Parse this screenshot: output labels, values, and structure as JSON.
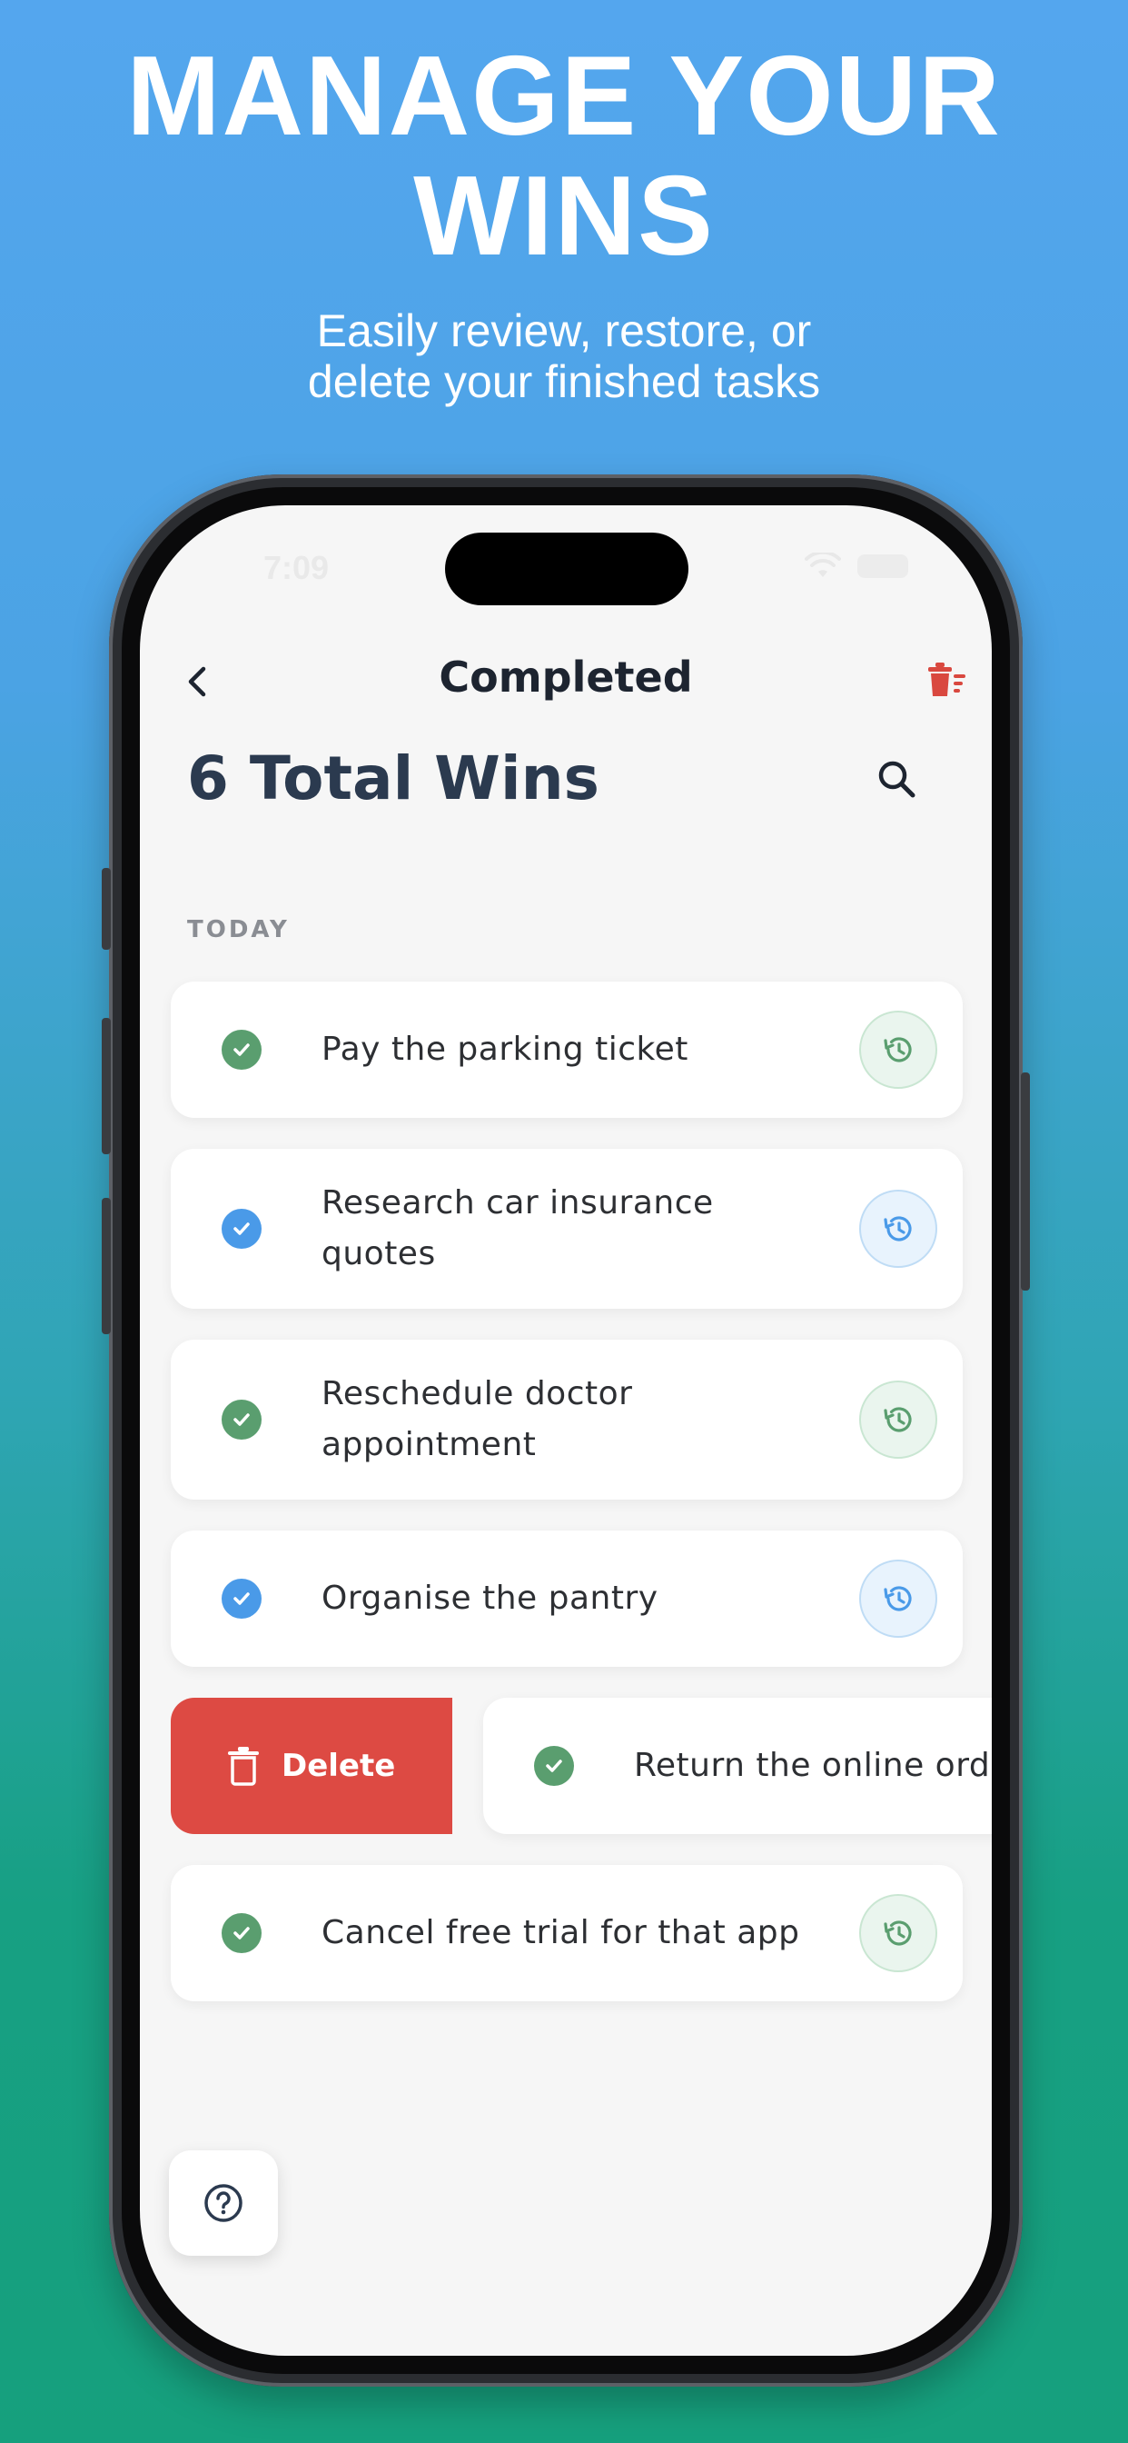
{
  "promo": {
    "headline_line1": "MANAGE YOUR",
    "headline_line2": "WINS",
    "subhead_line1": "Easily review, restore, or",
    "subhead_line2": "delete your finished tasks"
  },
  "status_bar": {
    "time": "7:09"
  },
  "nav": {
    "title": "Completed",
    "back_icon": "chevron-left-icon",
    "clear_icon": "trash-sweep-icon"
  },
  "header": {
    "total_wins": "6 Total Wins",
    "search_icon": "search-icon"
  },
  "section": {
    "label": "TODAY"
  },
  "tasks": [
    {
      "text": "Pay the parking ticket",
      "check_color": "#5a9e6f",
      "variant": "green"
    },
    {
      "text": "Research car insurance quotes",
      "check_color": "#4a9ae8",
      "variant": "blue"
    },
    {
      "text": "Reschedule doctor appointment",
      "check_color": "#5a9e6f",
      "variant": "green"
    },
    {
      "text": "Organise the pantry",
      "check_color": "#4a9ae8",
      "variant": "blue"
    },
    {
      "text": "Return the online ord",
      "check_color": "#5a9e6f",
      "variant": "green"
    },
    {
      "text": "Cancel free trial for that app",
      "check_color": "#5a9e6f",
      "variant": "green"
    }
  ],
  "swipe_action": {
    "label": "Delete",
    "color": "#dd4a43"
  },
  "help": {
    "icon": "help-circle-icon"
  },
  "colors": {
    "accent_green": "#5a9e6f",
    "accent_blue": "#4a9ae8",
    "danger": "#dd4a43",
    "title": "#2b3a4f"
  }
}
